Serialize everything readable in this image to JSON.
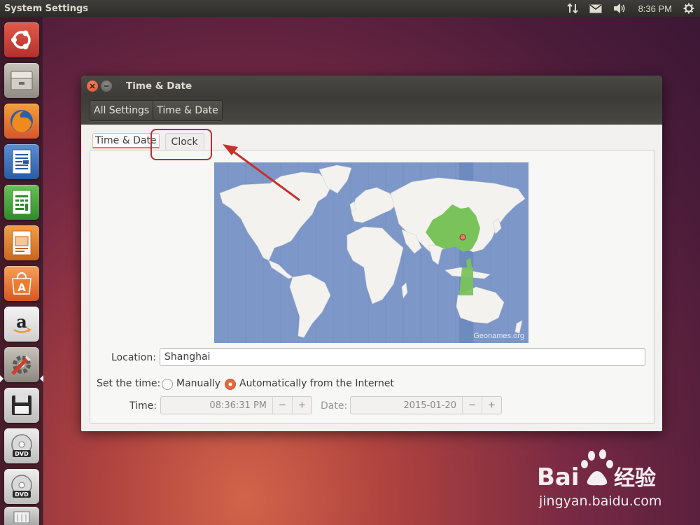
{
  "top_panel": {
    "app_title": "System Settings",
    "clock": "8:36 PM"
  },
  "window": {
    "title": "Time & Date",
    "breadcrumbs": [
      "All Settings",
      "Time & Date"
    ],
    "tabs": [
      "Time & Date",
      "Clock"
    ],
    "map": {
      "credit": "Geonames.org",
      "selected_city": "Shanghai",
      "highlight_color": "#7ac35a"
    },
    "location": {
      "label": "Location:",
      "value": "Shanghai"
    },
    "set_time": {
      "label": "Set the time:",
      "options": [
        "Manually",
        "Automatically from the Internet"
      ],
      "selected": "Automatically from the Internet"
    },
    "time": {
      "label": "Time:",
      "value": "08:36:31 PM",
      "minus": "−",
      "plus": "+"
    },
    "date": {
      "label": "Date:",
      "value": "2015-01-20",
      "minus": "−",
      "plus": "+"
    }
  },
  "launcher": {
    "items": [
      "ubuntu-dash-icon",
      "files-icon",
      "firefox-icon",
      "writer-icon",
      "calc-icon",
      "impress-icon",
      "software-center-icon",
      "amazon-icon",
      "system-settings-icon",
      "floppy-icon",
      "dvd-icon",
      "dvd-icon",
      "trash-icon"
    ]
  },
  "watermark": {
    "brand": "Bai du 经验",
    "site": "jingyan.baidu.com"
  },
  "colors": {
    "accent": "#f07746",
    "annotation": "#c32b2b"
  }
}
